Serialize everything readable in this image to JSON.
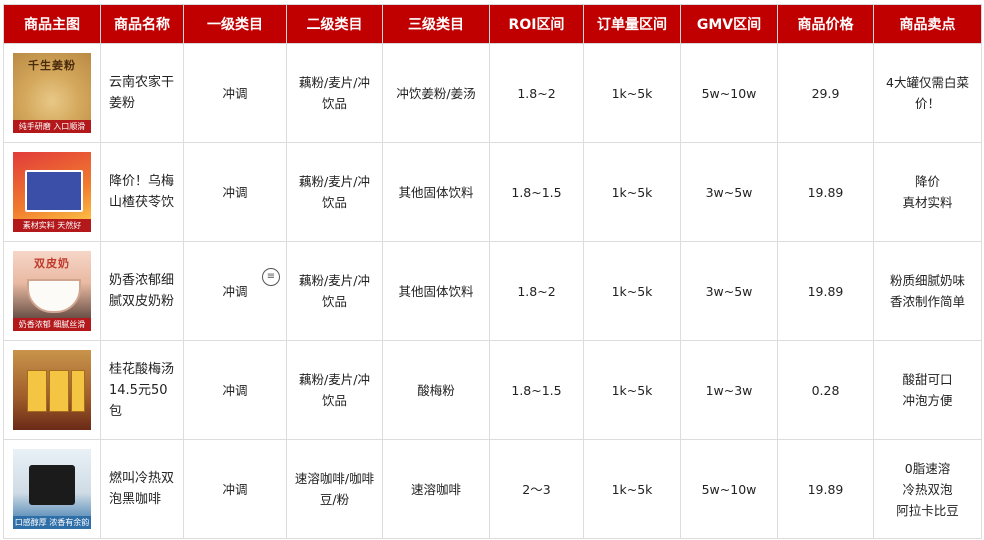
{
  "headers": [
    "商品主图",
    "商品名称",
    "一级类目",
    "二级类目",
    "三级类目",
    "ROI区间",
    "订单量区间",
    "GMV区间",
    "商品价格",
    "商品卖点"
  ],
  "rows": [
    {
      "image_top": "千生姜粉",
      "image_caption": "纯手研磨 入口顺滑",
      "name": "云南农家干姜粉",
      "cat1": "冲调",
      "cat2": "藕粉/麦片/冲饮品",
      "cat3": "冲饮姜粉/姜汤",
      "roi": "1.8~2",
      "orders": "1k~5k",
      "gmv": "5w~10w",
      "price": "29.9",
      "selling_points": [
        "4大罐仅需白菜价！"
      ]
    },
    {
      "image_top": "",
      "image_caption": "素材实料 天然好",
      "name": "降价！乌梅山楂茯苓饮",
      "cat1": "冲调",
      "cat2": "藕粉/麦片/冲饮品",
      "cat3": "其他固体饮料",
      "roi": "1.8~1.5",
      "orders": "1k~5k",
      "gmv": "3w~5w",
      "price": "19.89",
      "selling_points": [
        "降价",
        "真材实料"
      ]
    },
    {
      "image_top": "双皮奶",
      "image_caption": "奶香浓郁 细腻丝滑",
      "name": "奶香浓郁细腻双皮奶粉",
      "cat1": "冲调",
      "cat2": "藕粉/麦片/冲饮品",
      "cat3": "其他固体饮料",
      "roi": "1.8~2",
      "orders": "1k~5k",
      "gmv": "3w~5w",
      "price": "19.89",
      "selling_points": [
        "粉质细腻奶味香浓制作简单"
      ]
    },
    {
      "image_top": "",
      "image_caption": "",
      "name": "桂花酸梅汤14.5元50包",
      "cat1": "冲调",
      "cat2": "藕粉/麦片/冲饮品",
      "cat3": "酸梅粉",
      "roi": "1.8~1.5",
      "orders": "1k~5k",
      "gmv": "1w~3w",
      "price": "0.28",
      "selling_points": [
        "酸甜可口",
        "冲泡方便"
      ]
    },
    {
      "image_top": "",
      "image_caption": "口感醇厚 浓香有余韵",
      "name": "燃叫冷热双泡黑咖啡",
      "cat1": "冲调",
      "cat2": "速溶咖啡/咖啡豆/粉",
      "cat3": "速溶咖啡",
      "roi": "2～3",
      "orders": "1k~5k",
      "gmv": "5w~10w",
      "price": "19.89",
      "selling_points": [
        "0脂速溶",
        "冷热双泡",
        "阿拉卡比豆"
      ]
    }
  ],
  "menu_icon": "row-menu-icon"
}
